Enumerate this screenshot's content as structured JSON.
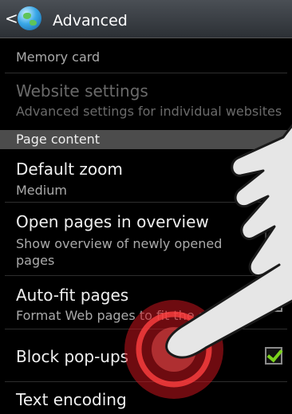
{
  "actionbar": {
    "back": "<",
    "title": "Advanced"
  },
  "rows": {
    "memory": {
      "subtitle": "Memory card"
    },
    "website": {
      "title": "Website settings",
      "subtitle": "Advanced settings for individual websites"
    },
    "section": "Page content",
    "zoom": {
      "title": "Default zoom",
      "subtitle": "Medium"
    },
    "overview": {
      "title": "Open pages in overview",
      "subtitle_1": "Show overview of newly opened",
      "subtitle_2": "pages",
      "checked": true
    },
    "autofit": {
      "title": "Auto-fit pages",
      "subtitle": "Format Web pages to fit the screen",
      "checked": false
    },
    "popups": {
      "title": "Block pop-ups",
      "checked": true
    },
    "encoding": {
      "title": "Text encoding"
    }
  },
  "colors": {
    "accent": "#7bd21d",
    "tap": "#c8141e"
  },
  "icons": {
    "globe": "globe-icon",
    "back": "chevron-left-icon",
    "hand": "pointing-hand-icon"
  }
}
